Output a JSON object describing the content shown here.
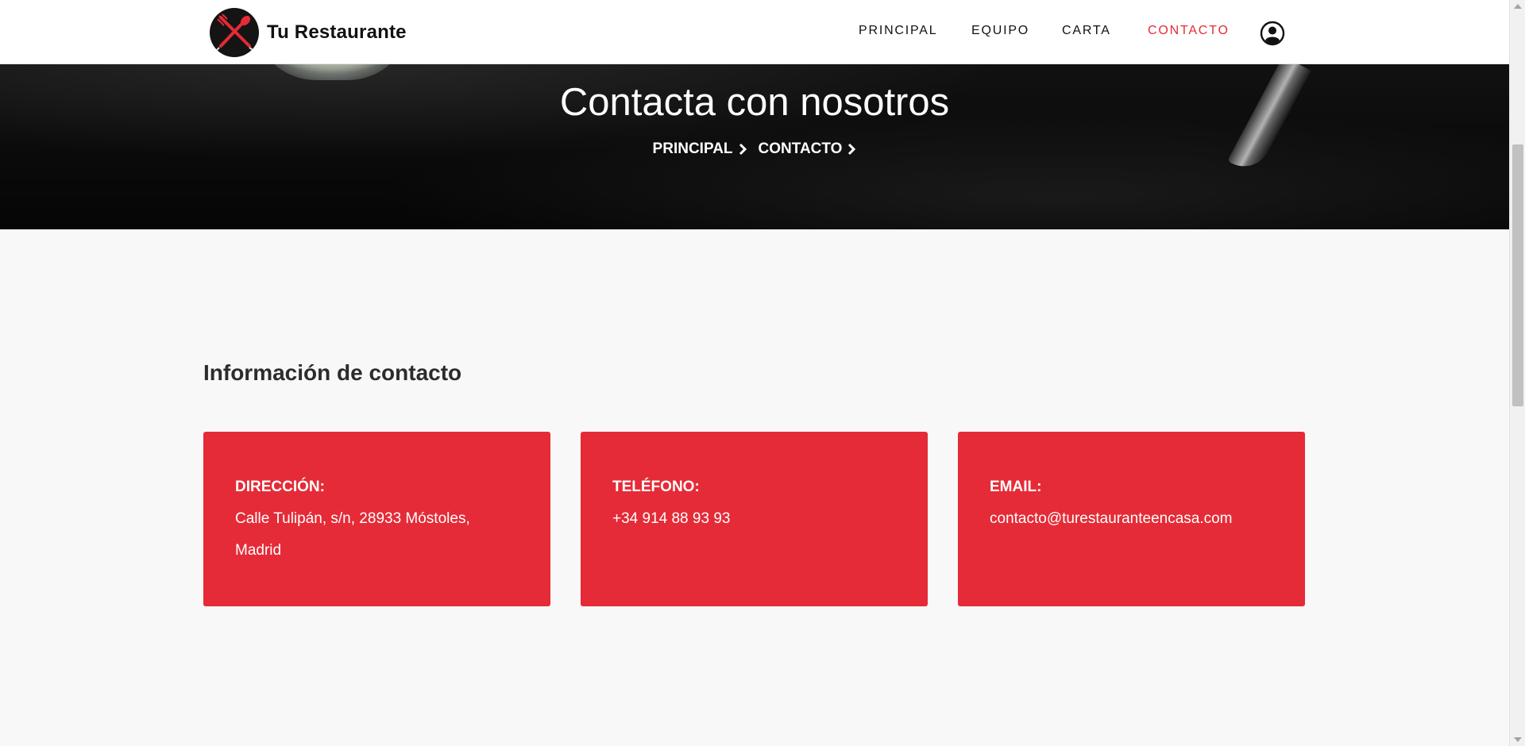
{
  "header": {
    "brand_name": "Tu Restaurante",
    "logo_icon": "crossed-fork-spoon-icon",
    "nav": [
      {
        "label": "PRINCIPAL",
        "active": false
      },
      {
        "label": "EQUIPO",
        "active": false
      },
      {
        "label": "CARTA",
        "active": false
      },
      {
        "label": "CONTACTO",
        "active": true
      }
    ],
    "user_icon": "user-circle-icon"
  },
  "hero": {
    "title": "Contacta con nosotros",
    "breadcrumb": [
      {
        "label": "PRINCIPAL"
      },
      {
        "label": "CONTACTO"
      }
    ]
  },
  "contact": {
    "section_title": "Información de contacto",
    "cards": [
      {
        "label": "DIRECCIÓN:",
        "value_line1": "Calle Tulipán, s/n, 28933 Móstoles,",
        "value_line2": "Madrid"
      },
      {
        "label": "TELÉFONO:",
        "value_line1": "+34 914 88 93 93"
      },
      {
        "label": "EMAIL:",
        "value_line1": "contacto@turestauranteencasa.com"
      }
    ]
  },
  "colors": {
    "accent": "#e52b37",
    "navbar_bg": "#ffffff",
    "page_bg": "#f8f8f8",
    "hero_bg": "#0a0a0a"
  }
}
